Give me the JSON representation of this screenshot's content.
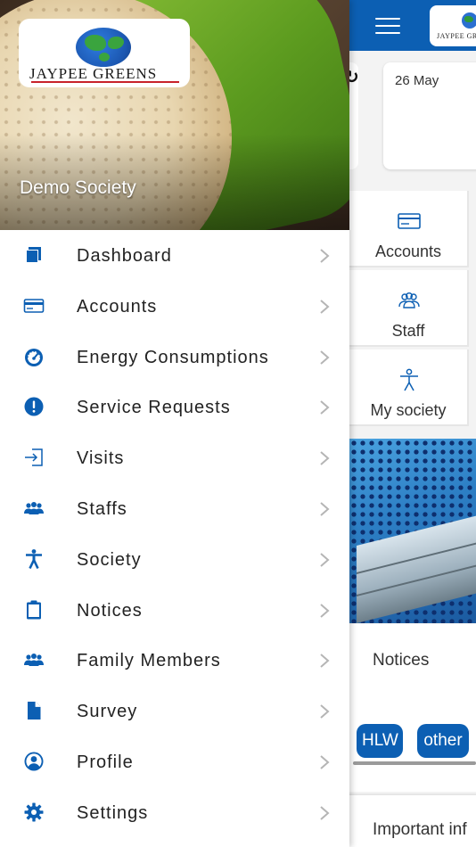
{
  "app": {
    "date": "26 May",
    "tiles": [
      {
        "label": "Accounts",
        "icon": "credit-card-icon"
      },
      {
        "label": "Staff",
        "icon": "people-icon"
      },
      {
        "label": "My society",
        "icon": "person-outline-icon"
      }
    ],
    "notices": {
      "title": "Notices",
      "chips": [
        "HLW",
        "other"
      ]
    },
    "important_text": "Important inf"
  },
  "drawer": {
    "logo_text": "JAYPEE GREENS",
    "society_name": "Demo Society",
    "items": [
      {
        "label": "Dashboard",
        "icon": "dashboard-icon"
      },
      {
        "label": "Accounts",
        "icon": "credit-card-icon"
      },
      {
        "label": "Energy Consumptions",
        "icon": "speedometer-icon"
      },
      {
        "label": "Service Requests",
        "icon": "alert-icon"
      },
      {
        "label": "Visits",
        "icon": "sign-in-icon"
      },
      {
        "label": "Staffs",
        "icon": "group-icon"
      },
      {
        "label": "Society",
        "icon": "accessibility-icon"
      },
      {
        "label": "Notices",
        "icon": "clipboard-icon"
      },
      {
        "label": "Family Members",
        "icon": "group-icon"
      },
      {
        "label": "Survey",
        "icon": "document-icon"
      },
      {
        "label": "Profile",
        "icon": "user-circle-icon"
      },
      {
        "label": "Settings",
        "icon": "gear-icon"
      }
    ]
  },
  "colors": {
    "primary": "#0c5fb3",
    "text": "#222222",
    "chevron": "#b5b5b5"
  }
}
